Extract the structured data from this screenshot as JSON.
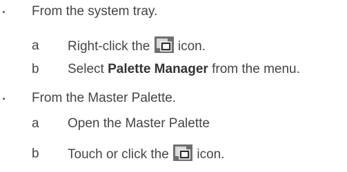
{
  "bullets": [
    {
      "text": "From the system tray.",
      "steps": [
        {
          "letter": "a",
          "before": "Right-click the",
          "icon": "palette-manager-icon",
          "after": "icon."
        },
        {
          "letter": "b",
          "before": "Select",
          "bold": "Palette Manager",
          "after": "from the menu."
        }
      ]
    },
    {
      "text": "From the Master Palette.",
      "steps": [
        {
          "letter": "a",
          "text": "Open the Master Palette"
        },
        {
          "letter": "b",
          "before": "Touch or click the",
          "icon": "palette-manager-icon",
          "after": "icon."
        }
      ]
    }
  ],
  "colors": {
    "text": "#444444",
    "icon_outer": "#6f6f6f",
    "icon_inner": "#d9d9d9"
  }
}
